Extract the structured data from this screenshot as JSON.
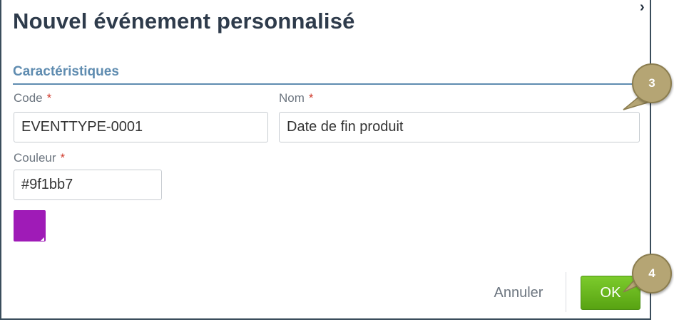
{
  "dialog": {
    "title": "Nouvel événement personnalisé",
    "close_icon": "close-icon"
  },
  "section": {
    "title": "Caractéristiques"
  },
  "fields": {
    "code": {
      "label": "Code",
      "required_mark": "*",
      "value": "EVENTTYPE-0001"
    },
    "name": {
      "label": "Nom",
      "required_mark": "*",
      "value": "Date de fin produit"
    },
    "color": {
      "label": "Couleur",
      "required_mark": "*",
      "value": "#9f1bb7",
      "swatch_color": "#9f1bb7"
    }
  },
  "actions": {
    "cancel_label": "Annuler",
    "ok_label": "OK"
  },
  "callouts": {
    "step3": "3",
    "step4": "4",
    "color": "#b5a574"
  },
  "colors": {
    "title": "#2e3b4b",
    "section": "#5f8cb0",
    "ok_button": "#6bb820",
    "required": "#d0392b"
  }
}
